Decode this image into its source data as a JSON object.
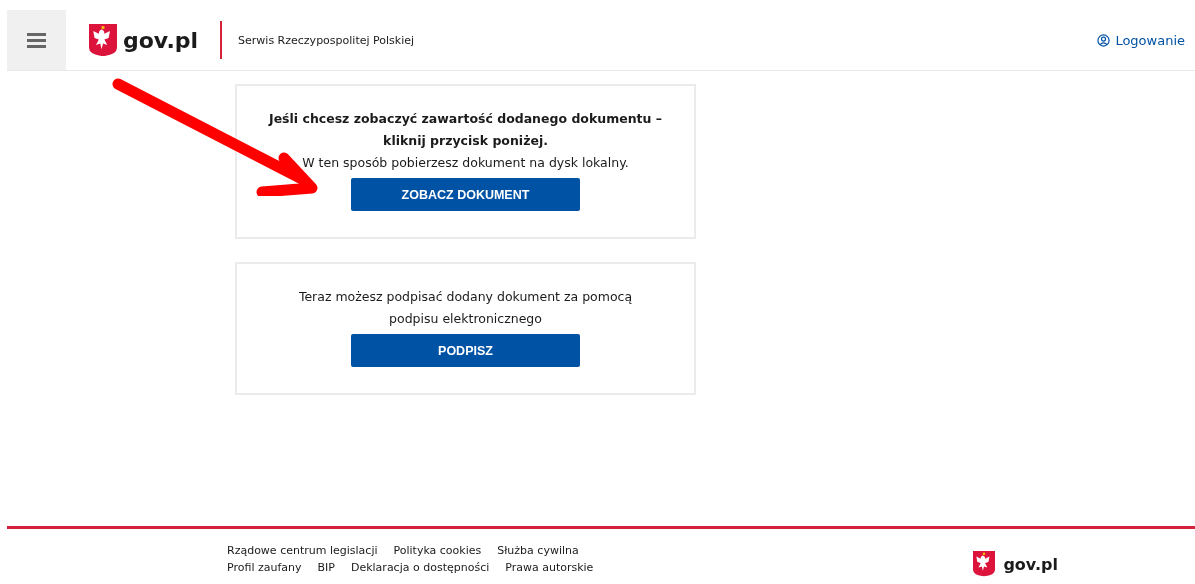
{
  "header": {
    "logo_text": "gov.pl",
    "service_name": "Serwis Rzeczypospolitej Polskiej",
    "login_link": "Logowanie"
  },
  "cards": [
    {
      "lines": [
        {
          "text": "Jeśli chcesz zobaczyć zawartość dodanego dokumentu –",
          "bold": true
        },
        {
          "text": "kliknij przycisk poniżej.",
          "bold": true
        },
        {
          "text": "W ten sposób pobierzesz dokument na dysk lokalny.",
          "bold": false
        }
      ],
      "button": "ZOBACZ DOKUMENT"
    },
    {
      "lines": [
        {
          "text": "Teraz możesz podpisać dodany dokument za pomocą",
          "bold": false
        },
        {
          "text": "podpisu elektronicznego",
          "bold": false
        }
      ],
      "button": "PODPISZ"
    }
  ],
  "footer": {
    "links_row_1": [
      "Rządowe centrum legislacji",
      "Polityka cookies",
      "Służba cywilna"
    ],
    "links_row_2": [
      "Profil zaufany",
      "BIP",
      "Deklaracja o dostępności",
      "Prawa autorskie"
    ],
    "logo_text": "gov.pl"
  }
}
